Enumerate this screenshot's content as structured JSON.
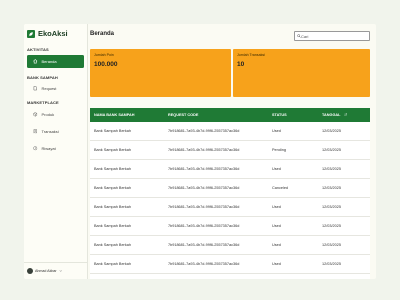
{
  "app": {
    "name": "EkoAksi",
    "brand_color": "#1f7a35",
    "accent_color": "#f7a21b"
  },
  "sidebar": {
    "sections": [
      {
        "label": "AKTIVITAS",
        "items": [
          {
            "label": "Beranda",
            "icon": "home-icon",
            "active": true
          }
        ]
      },
      {
        "label": "BANK SAMPAH",
        "items": [
          {
            "label": "Request",
            "icon": "document-icon",
            "active": false
          }
        ]
      },
      {
        "label": "MARKETPLACE",
        "items": [
          {
            "label": "Produk",
            "icon": "box-icon",
            "active": false
          },
          {
            "label": "Transaksi",
            "icon": "receipt-icon",
            "active": false
          },
          {
            "label": "Riwayat",
            "icon": "history-icon",
            "active": false
          }
        ]
      }
    ],
    "user": {
      "name": "Ahmad Akbar"
    }
  },
  "header": {
    "title": "Beranda",
    "search_placeholder": "Cari"
  },
  "cards": [
    {
      "label": "Jumlah Poin",
      "value": "100.000"
    },
    {
      "label": "Jumlah Transaksi",
      "value": "10"
    }
  ],
  "table": {
    "columns": [
      "NAMA BANK SAMPAH",
      "REQUEST CODE",
      "STATUS",
      "TANGGAL"
    ],
    "rows": [
      [
        "Bank Sampah Berkah",
        "7b918681-7a93-4b7d-99f6-2557357ac36d",
        "Used",
        "12/03/2025"
      ],
      [
        "Bank Sampah Berkah",
        "7b918681-7a93-4b7d-99f6-2557357ac36d",
        "Pending",
        "12/03/2025"
      ],
      [
        "Bank Sampah Berkah",
        "7b918681-7a93-4b7d-99f6-2557357ac36d",
        "Used",
        "12/03/2025"
      ],
      [
        "Bank Sampah Berkah",
        "7b918681-7a93-4b7d-99f6-2557357ac36d",
        "Canceled",
        "12/03/2025"
      ],
      [
        "Bank Sampah Berkah",
        "7b918681-7a93-4b7d-99f6-2557357ac36d",
        "Used",
        "12/03/2025"
      ],
      [
        "Bank Sampah Berkah",
        "7b918681-7a93-4b7d-99f6-2557357ac36d",
        "Used",
        "12/03/2025"
      ],
      [
        "Bank Sampah Berkah",
        "7b918681-7a93-4b7d-99f6-2557357ac36d",
        "Used",
        "12/03/2025"
      ],
      [
        "Bank Sampah Berkah",
        "7b918681-7a93-4b7d-99f6-2557357ac36d",
        "Used",
        "12/03/2025"
      ],
      [
        "Bank Sampah Berkah",
        "7b918681-7a93-4b7d-99f6-2557357ac36d",
        "Pending",
        "12/03/2025"
      ]
    ]
  }
}
